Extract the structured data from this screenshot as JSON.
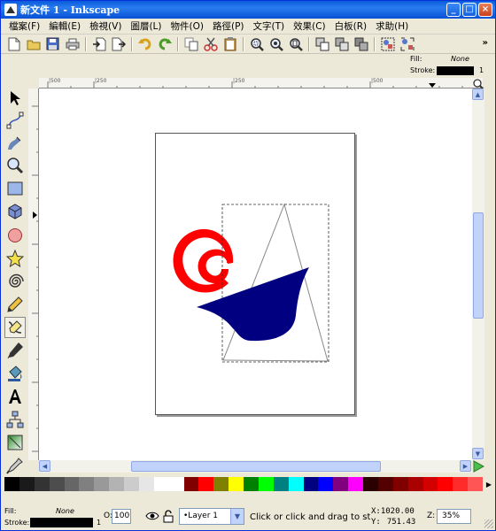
{
  "window": {
    "title": "新文件 1 - Inkscape"
  },
  "menu": [
    "檔案(F)",
    "編輯(E)",
    "檢視(V)",
    "圖層(L)",
    "物件(O)",
    "路徑(P)",
    "文字(T)",
    "效果(C)",
    "白板(R)",
    "求助(H)"
  ],
  "toolbar": {
    "buttons": [
      "new-document",
      "open",
      "save",
      "print",
      "import",
      "export",
      "undo",
      "redo",
      "copy",
      "cut",
      "paste",
      "zoom-selection",
      "zoom-drawing",
      "zoom-page",
      "duplicate",
      "clone",
      "unlink-clone",
      "group",
      "ungroup"
    ],
    "overflow": "»"
  },
  "style_indicator": {
    "fill_label": "Fill:",
    "fill_value": "None",
    "stroke_label": "Stroke:",
    "stroke_width": "1"
  },
  "rulers": {
    "h_labels": [
      "|500",
      "|250",
      "0",
      "|250",
      "|500",
      "|750"
    ],
    "v_labels": [
      "0",
      "250",
      "500",
      "750",
      "1000",
      "1250"
    ]
  },
  "palette": [
    "#000000",
    "#1a1a1a",
    "#333333",
    "#4d4d4d",
    "#666666",
    "#808080",
    "#999999",
    "#b3b3b3",
    "#cccccc",
    "#e6e6e6",
    "#ffffff",
    "#ffffff",
    "#800000",
    "#ff0000",
    "#808000",
    "#ffff00",
    "#008000",
    "#00ff00",
    "#008080",
    "#00ffff",
    "#000080",
    "#0000ff",
    "#800080",
    "#ff00ff",
    "#2b0000",
    "#550000",
    "#800000",
    "#aa0000",
    "#d40000",
    "#ff0000",
    "#ff2a2a",
    "#ff5555"
  ],
  "status": {
    "fill_label": "Fill:",
    "fill_value": "None",
    "stroke_label": "Stroke:",
    "stroke_width": "1",
    "opacity_label": "O:",
    "opacity_value": "100",
    "layer": "•Layer 1",
    "message": "Click or click and drag to start a",
    "x_label": "X:",
    "x_value": "1020.00",
    "y_label": "Y:",
    "y_value": "751.43",
    "zoom_label": "Z:",
    "zoom_value": "35%"
  },
  "colors": {
    "spiral": "#ff0000",
    "shape": "#000080",
    "title_bar": "#0a5bdb"
  }
}
